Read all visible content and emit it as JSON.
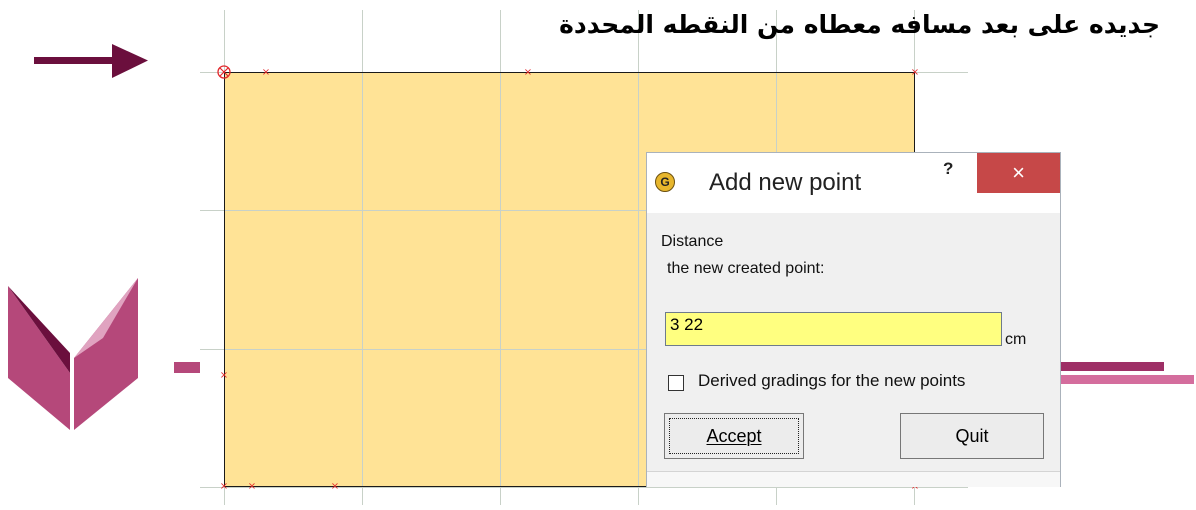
{
  "heading": "جديده على بعد مسافه معطاه من النقطه المحددة",
  "dialog": {
    "title": "Add new point",
    "help_label": "?",
    "close_label": "×",
    "app_icon_label": "G",
    "distance_label": "Distance",
    "distance_sublabel": "the new created point:",
    "distance_value": "3 22",
    "unit": "cm",
    "derived_gradings_label": "Derived gradings for the new points",
    "derived_gradings_checked": false,
    "accept_label": "Accept",
    "quit_label": "Quit"
  },
  "canvas": {
    "piece_color": "#ffe396",
    "marker_color": "#e2262a",
    "marker_glyph": "×"
  },
  "decor": {
    "arrow_color": "#6b0f3d",
    "logo_colors": [
      "#6b0f3d",
      "#b5487a",
      "#e0a3c0"
    ],
    "stripe_color": "#b5487a"
  }
}
